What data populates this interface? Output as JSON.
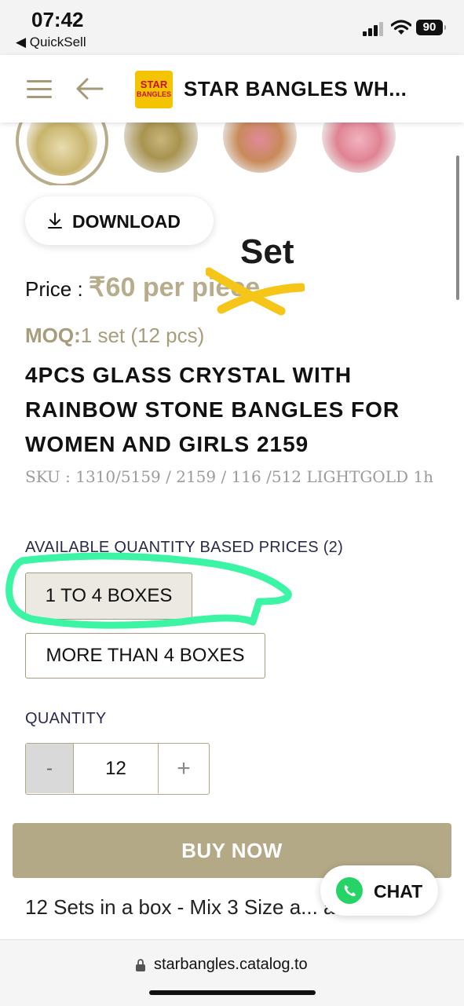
{
  "status_bar": {
    "time": "07:42",
    "back_app": "◀ QuickSell",
    "battery": "90"
  },
  "header": {
    "logo_line1": "STAR",
    "logo_line2": "BANGLES",
    "title": "STAR BANGLES WH..."
  },
  "download": {
    "label": "DOWNLOAD"
  },
  "annotation": {
    "set_text": "Set"
  },
  "price": {
    "label": "Price : ",
    "value": "₹60 per piece"
  },
  "moq": {
    "label": "MOQ:",
    "value": "1 set (12 pcs)"
  },
  "product": {
    "name": "4PCS GLASS CRYSTAL WITH RAINBOW STONE BANGLES FOR WOMEN AND GIRLS 2159",
    "sku": "SKU : 1310/5159 / 2159 / 116 /512 LIGHTGOLD 1h"
  },
  "quantity_prices": {
    "label": "AVAILABLE QUANTITY BASED PRICES (2)",
    "options": [
      {
        "label": "1 TO 4 BOXES",
        "selected": true
      },
      {
        "label": "MORE THAN 4 BOXES",
        "selected": false
      }
    ]
  },
  "quantity": {
    "label": "QUANTITY",
    "minus": "-",
    "value": "12",
    "plus": "+"
  },
  "buy_now": {
    "label": "BUY NOW"
  },
  "description": {
    "text": "12 Sets in a box - Mix 3 Size a... a box"
  },
  "chat": {
    "label": "CHAT"
  },
  "browser": {
    "url": "starbangles.catalog.to"
  },
  "colors": {
    "accent": "#b3a987",
    "highlight_marker": "#3cf5a4",
    "scribble": "#f5c518",
    "brand_logo": "#f5c400"
  },
  "icons": [
    "menu-icon",
    "back-arrow-icon",
    "download-icon",
    "whatsapp-icon",
    "lock-icon",
    "signal-icon",
    "wifi-icon",
    "battery-icon"
  ]
}
